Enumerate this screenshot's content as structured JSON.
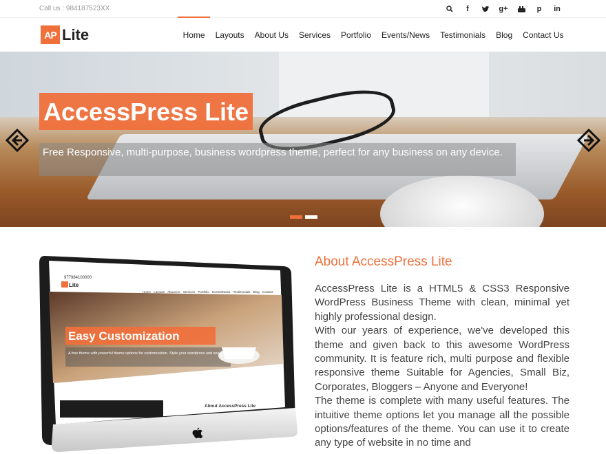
{
  "topbar": {
    "call": "Call us : 984187523XX",
    "social": [
      {
        "icon": "search-icon",
        "glyph": "⚲"
      },
      {
        "icon": "facebook-icon",
        "glyph": "f"
      },
      {
        "icon": "twitter-icon",
        "glyph": "t"
      },
      {
        "icon": "google-plus-icon",
        "glyph": "g+"
      },
      {
        "icon": "youtube-icon",
        "glyph": "▶"
      },
      {
        "icon": "pinterest-icon",
        "glyph": "p"
      },
      {
        "icon": "linkedin-icon",
        "glyph": "in"
      }
    ]
  },
  "header": {
    "logo_mark": "AP",
    "logo_text": "Lite",
    "nav": [
      "Home",
      "Layouts",
      "About Us",
      "Services",
      "Portfolio",
      "Events/News",
      "Testimonials",
      "Blog",
      "Contact Us"
    ],
    "active": "Home"
  },
  "hero": {
    "title": "AccessPress Lite",
    "subtitle": "Free Responsive, multi-purpose, business wordpress theme, perfect for any business on any device.",
    "slides": 2,
    "active_slide": 1
  },
  "about": {
    "title": "About AccessPress Lite",
    "paragraphs": [
      "AccessPress Lite is a HTML5 & CSS3 Responsive WordPress Business Theme with clean, minimal yet highly professional design.",
      "With our years of experience, we've developed this theme and given back to this awesome WordPress community. It is feature rich, multi purpose and flexible responsive theme Suitable for Agencies, Small Biz, Corporates, Bloggers – Anyone and Everyone!",
      "The theme is complete with many useful features. The intuitive theme options let you manage all the possible options/features of the theme. You can use it to create any type of website in no time and"
    ],
    "monitor": {
      "phone": "977984100000",
      "logo_text": "Lite",
      "nav": [
        "Home",
        "Layouts",
        "About Us",
        "Services",
        "Portfolio",
        "Events/News",
        "Testimonials",
        "Blog",
        "Contact"
      ],
      "slide_title": "Easy Customization",
      "slide_sub": "A free theme with powerful theme options for customization. Style your wordpress and see changes live!",
      "about_title": "About AccessPress Lite"
    }
  },
  "colors": {
    "accent": "#f0703c"
  }
}
